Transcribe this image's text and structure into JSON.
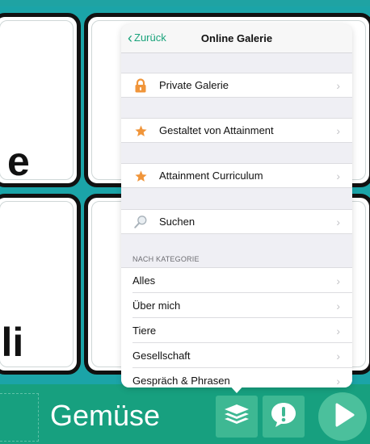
{
  "background": {
    "tiles": [
      {
        "word": "e"
      },
      {
        "word": ""
      },
      {
        "word": "oli"
      },
      {
        "word": ""
      }
    ],
    "category_label": "Gemüse",
    "buttons": {
      "layers": "layers-icon",
      "alert": "speech-bubble-exclamation-icon",
      "play": "play-icon"
    },
    "colors": {
      "grid": "#1ba4a8",
      "bar": "#17a07f",
      "button": "#3eb893"
    }
  },
  "popover": {
    "back_label": "Zurück",
    "title": "Online Galerie",
    "items": [
      {
        "label": "Private Galerie",
        "icon": "lock-icon"
      },
      {
        "label": "Gestaltet von Attainment",
        "icon": "star-icon"
      },
      {
        "label": "Attainment Curriculum",
        "icon": "star-icon"
      },
      {
        "label": "Suchen",
        "icon": "magnifier-icon"
      }
    ],
    "section_header": "NACH KATEGORIE",
    "categories": [
      "Alles",
      "Über mich",
      "Tiere",
      "Gesellschaft",
      "Gespräch & Phrasen"
    ],
    "chevron": "›",
    "accent": "#1aa37b"
  }
}
